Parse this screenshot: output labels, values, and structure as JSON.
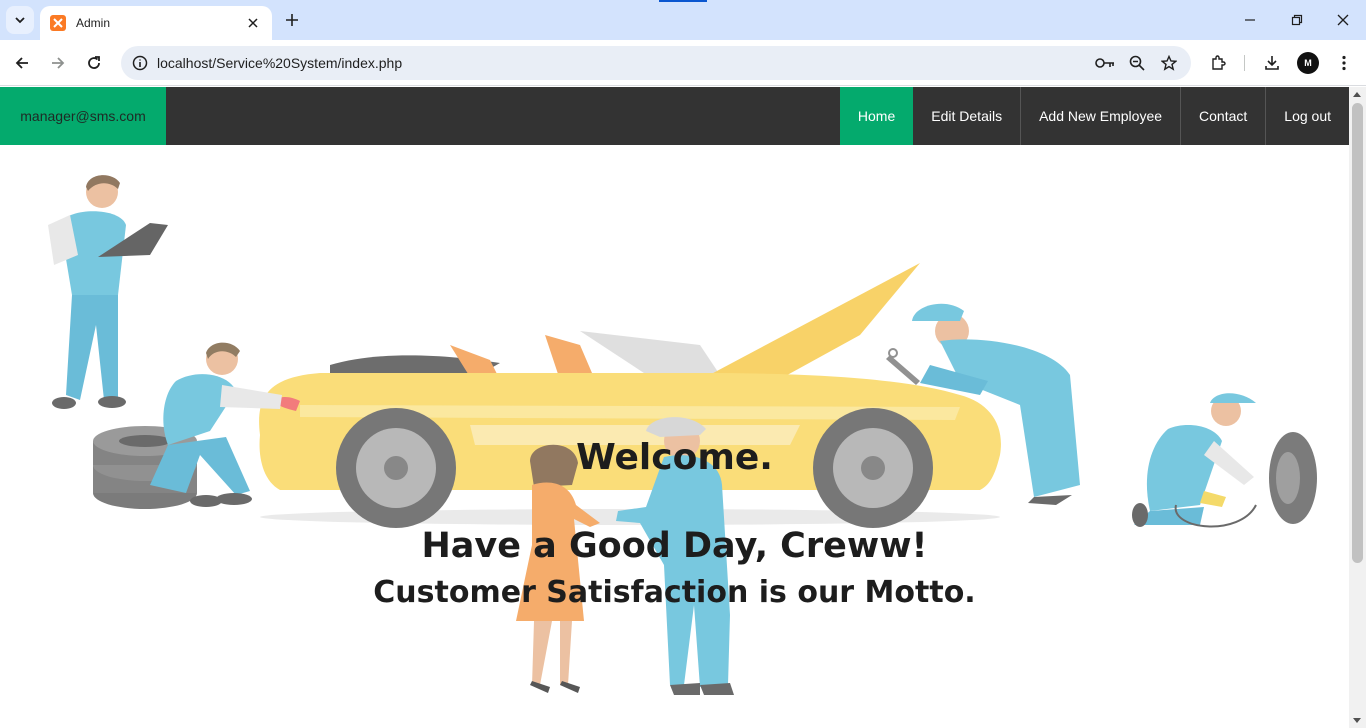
{
  "browser": {
    "tab_title": "Admin",
    "url": "localhost/Service%20System/index.php",
    "profile_initial": "M"
  },
  "nav": {
    "user_email": "manager@sms.com",
    "links": [
      {
        "label": "Home",
        "active": true
      },
      {
        "label": "Edit Details",
        "active": false
      },
      {
        "label": "Add New Employee",
        "active": false
      },
      {
        "label": "Contact",
        "active": false
      },
      {
        "label": "Log out",
        "active": false
      }
    ]
  },
  "hero": {
    "welcome": "Welcome.",
    "greeting": "Have a Good Day, Creww!",
    "motto": "Customer Satisfaction is our Motto."
  },
  "colors": {
    "accent_green": "#04aa6d",
    "navbar_bg": "#333333",
    "car_yellow": "#f9d65c",
    "uniform_blue": "#5bbcd8"
  },
  "icons": [
    "tab-search-icon",
    "xampp-favicon-icon",
    "close-icon",
    "plus-icon",
    "back-icon",
    "forward-icon",
    "reload-icon",
    "info-icon",
    "key-icon",
    "zoom-icon",
    "star-icon",
    "extensions-icon",
    "download-icon",
    "menu-dots-icon",
    "minimize-icon",
    "restore-icon"
  ]
}
